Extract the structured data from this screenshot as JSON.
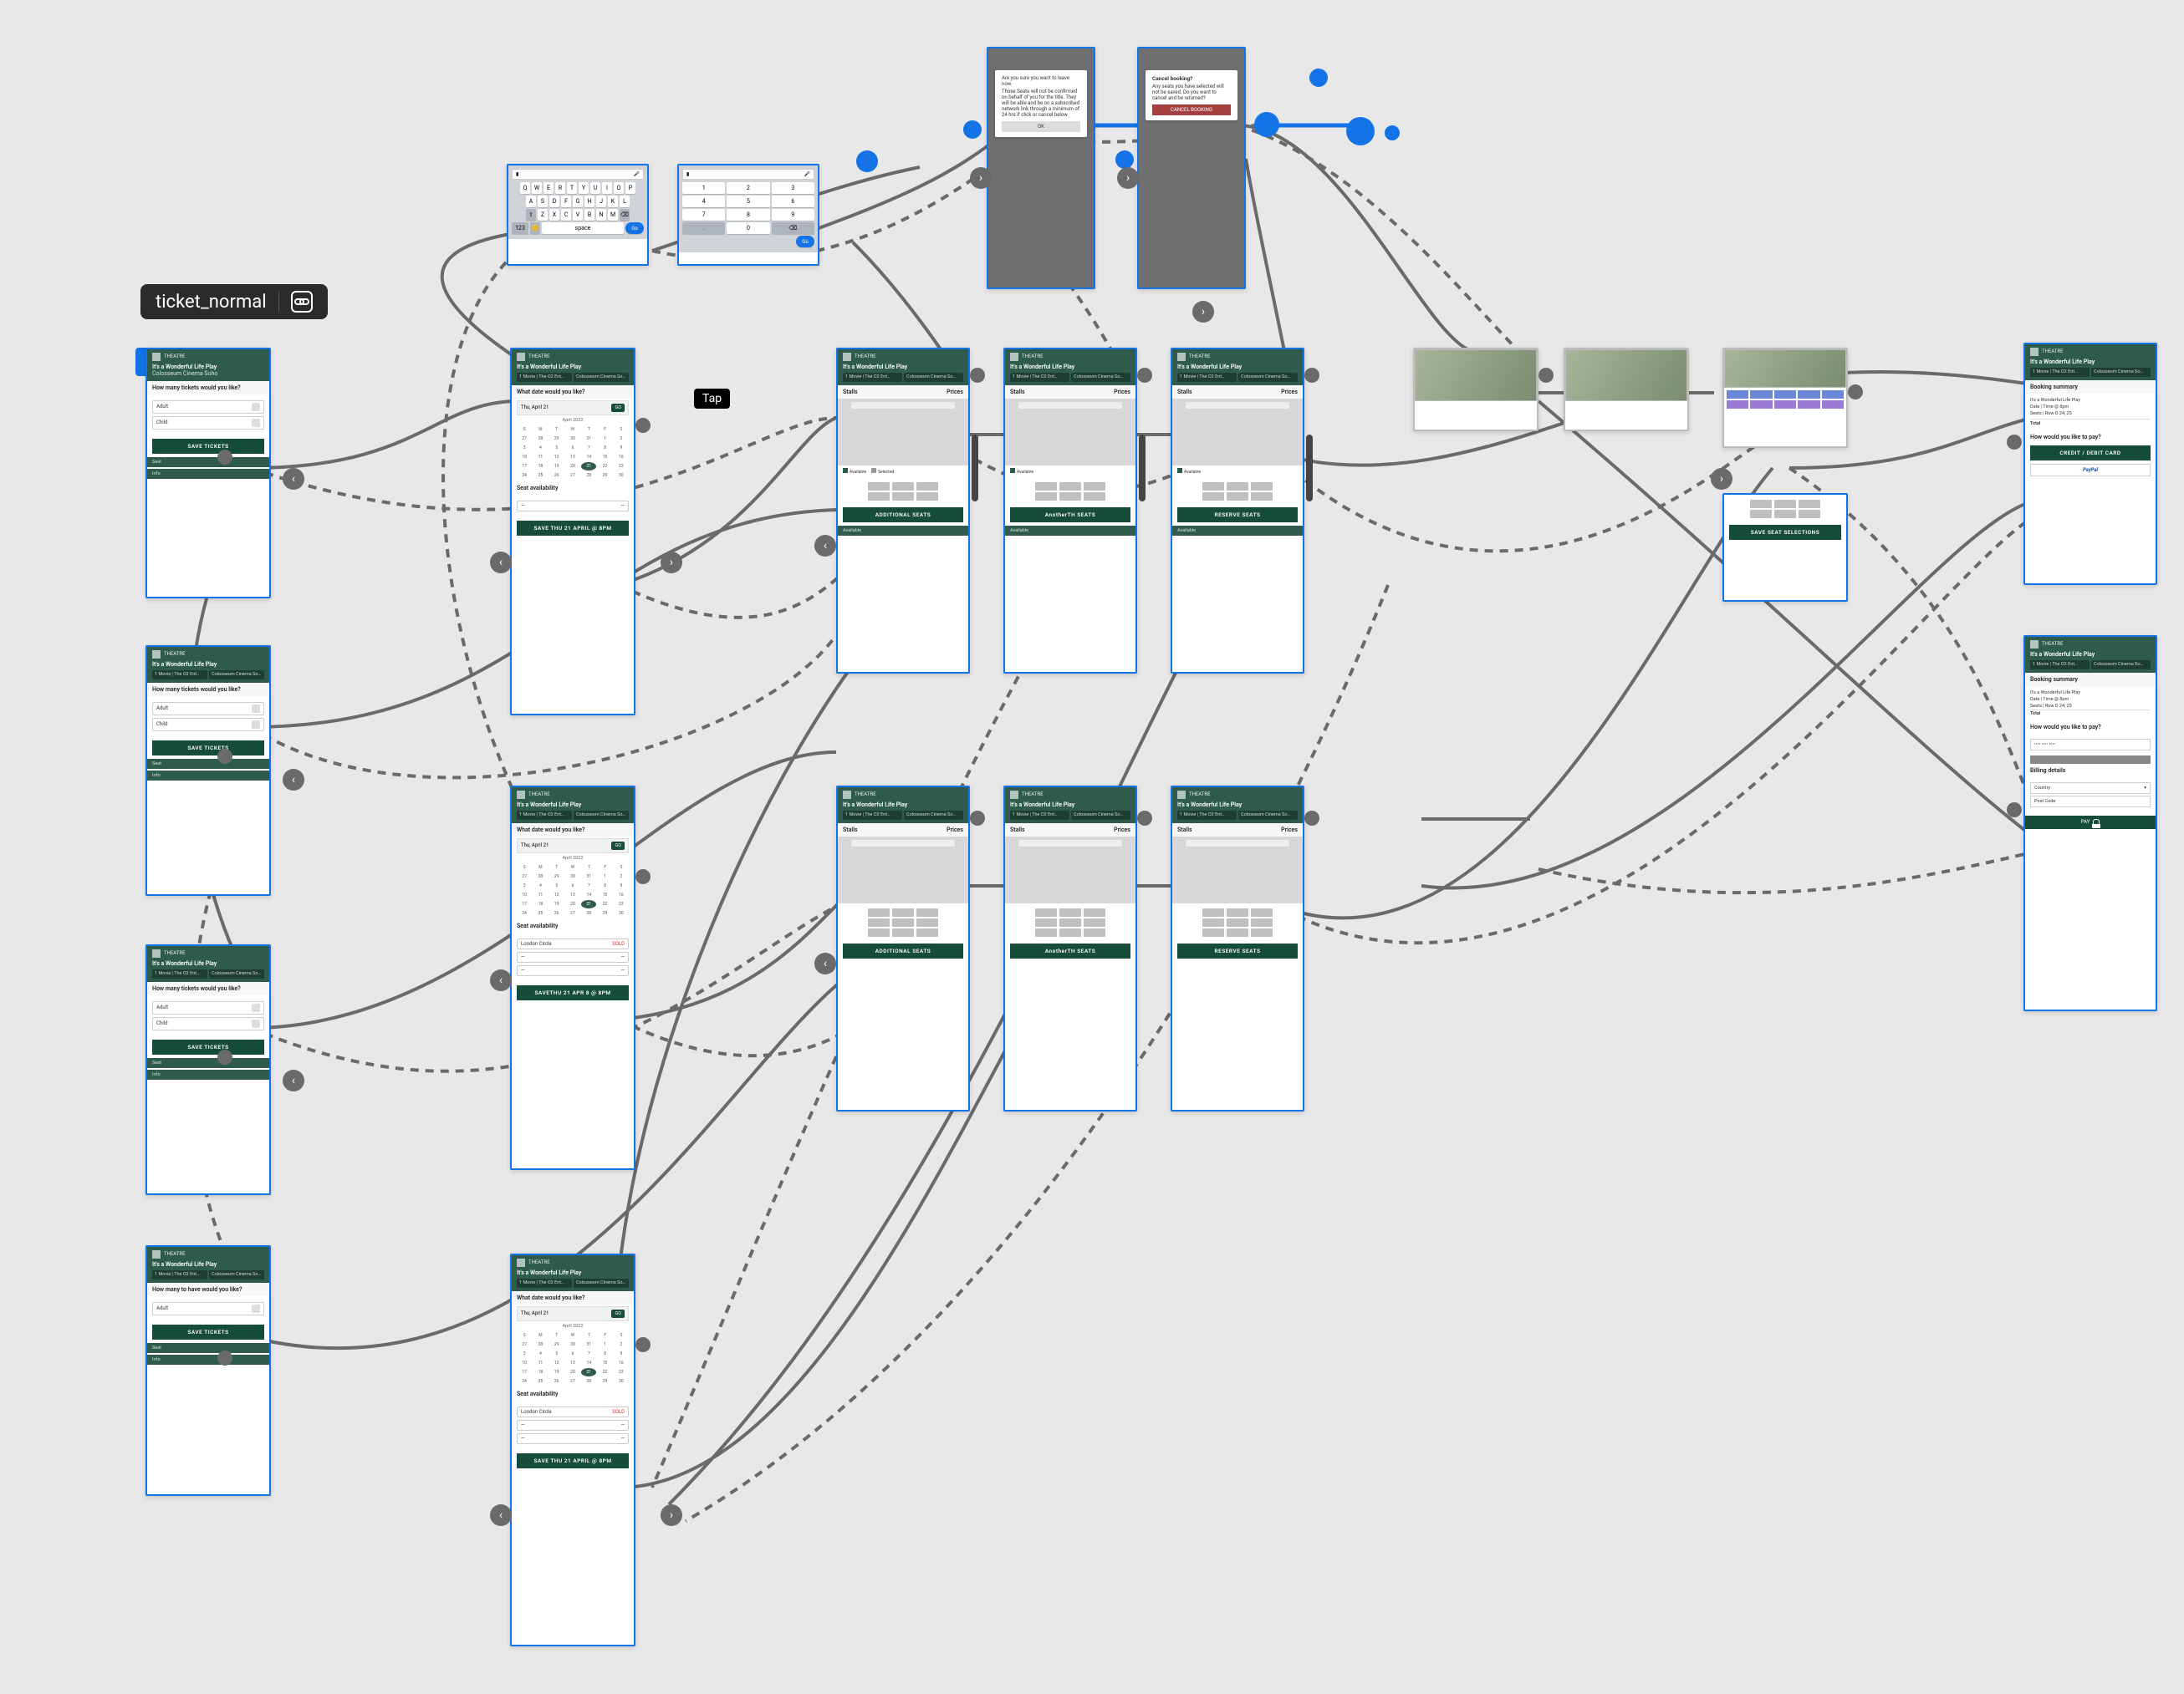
{
  "tooltip": {
    "label": "ticket_normal"
  },
  "tap_badge": "Tap",
  "app": {
    "logo_text": "THEATRE",
    "show_title": "It's a Wonderful Life Play",
    "venue": "Colosseum Cinema Soho",
    "chip_left": "1 Movie | The O2 Ent…",
    "chip_right": "Colosseum Cinema So…"
  },
  "tickets": {
    "question": "How many tickets would you like?",
    "question_alt": "How many to have would you like?",
    "rows": {
      "adult": "Adult",
      "child": "Child"
    },
    "save_btn": "SAVE TICKETS",
    "footer_a": "Seat",
    "footer_b": "Info"
  },
  "date": {
    "question": "What date would you like?",
    "display": "Thu, April 21",
    "go": "GO",
    "month": "April 2022",
    "dows": [
      "S",
      "M",
      "T",
      "W",
      "T",
      "F",
      "S"
    ],
    "days": [
      "27",
      "28",
      "29",
      "30",
      "31",
      "1",
      "2",
      "3",
      "4",
      "5",
      "6",
      "7",
      "8",
      "9",
      "10",
      "11",
      "12",
      "13",
      "14",
      "15",
      "16",
      "17",
      "18",
      "19",
      "20",
      "21",
      "22",
      "23",
      "24",
      "25",
      "26",
      "27",
      "28",
      "29",
      "30"
    ],
    "selected": "21",
    "availability_title": "Seat availability",
    "save_btn": "SAVE THU 21 APRIL @ 8PM",
    "save_btn_alt": "SAVETHU 21 APR 8 @ 8PM"
  },
  "seats": {
    "header_left": "Stalls",
    "header_right": "Prices",
    "additional": "ADDITIONAL SEATS",
    "another": "AnotherTH SEATS",
    "reserve": "RESERVE SEATS",
    "save_seat_btn": "SAVE SEAT SELECTIONS",
    "legend_a": "Available",
    "legend_b": "Selected"
  },
  "checkout": {
    "summary_title": "Booking summary",
    "line_show": "It's a Wonderful Life Play",
    "line_date": "Date | Time @ 8pm",
    "line_seats": "Seats | Row D 24, 25",
    "line_total": "Total",
    "pay_q": "How would you like to pay?",
    "credit_btn": "CREDIT / DEBIT CARD",
    "paypal": "PayPal",
    "billing_title": "Billing details",
    "country_label": "Country",
    "postcode_label": "Post Code",
    "pay_btn": "PAY"
  },
  "keyboard": {
    "field_value": "",
    "row1": [
      "Q",
      "W",
      "E",
      "R",
      "T",
      "Y",
      "U",
      "I",
      "O",
      "P"
    ],
    "row2": [
      "A",
      "S",
      "D",
      "F",
      "G",
      "H",
      "J",
      "K",
      "L"
    ],
    "row3": [
      "⇧",
      "Z",
      "X",
      "C",
      "V",
      "B",
      "N",
      "M",
      "⌫"
    ],
    "row4_left": "123",
    "row4_emoji": "😊",
    "row4_space": "space",
    "row4_go": "Go",
    "num_row1": [
      "1",
      "2",
      "3"
    ],
    "num_row2": [
      "4",
      "5",
      "6"
    ],
    "num_row3": [
      "7",
      "8",
      "9"
    ],
    "num_row4": [
      ".",
      "0",
      "⌫"
    ]
  },
  "dialogs": {
    "leave": {
      "lead": "Are you sure you want to leave now.",
      "body": "Those Seats will not be confirmed on behalf of you for the title. They will be able and be on a subscribed network link through a minimum of 24 hrs if click or cancel below.",
      "btn": "OK"
    },
    "cancel": {
      "title": "Cancel booking?",
      "body": "Any seats you have selected will not be saved. Do you want to cancel and be returned?",
      "btn": "CANCEL BOOKING"
    }
  }
}
